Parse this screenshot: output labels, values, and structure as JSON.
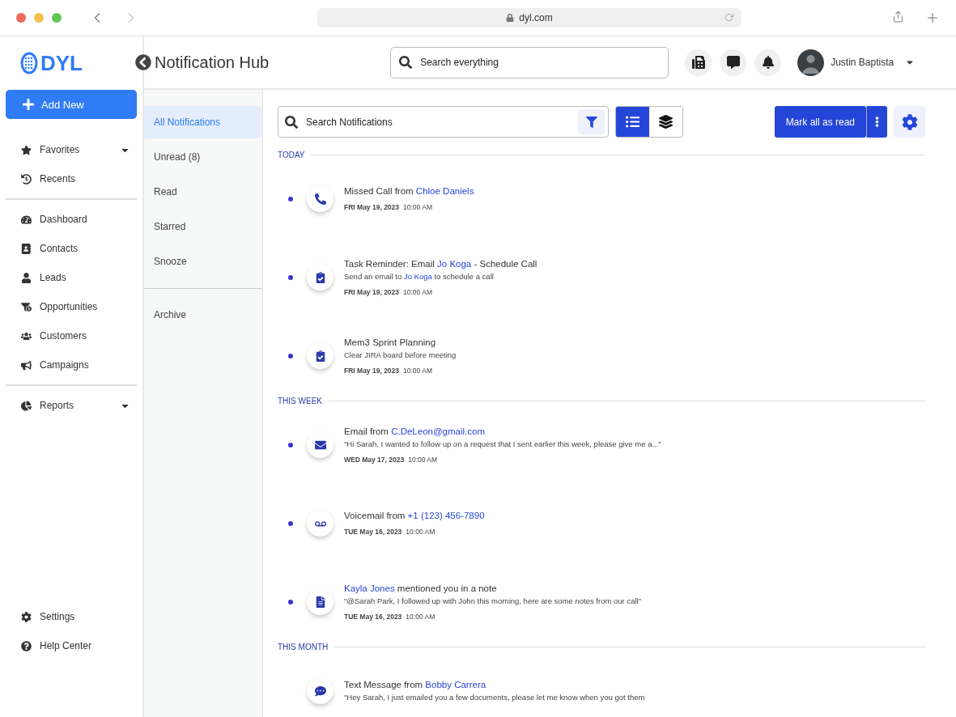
{
  "browser": {
    "url": "dyl.com"
  },
  "sidebar": {
    "logo": "DYL",
    "add_button": "Add New",
    "groups": [
      [
        {
          "label": "Favorites",
          "has_menu": true
        },
        {
          "label": "Recents",
          "has_menu": false
        }
      ],
      [
        {
          "label": "Dashboard",
          "has_menu": false
        },
        {
          "label": "Contacts",
          "has_menu": false
        },
        {
          "label": "Leads",
          "has_menu": false
        },
        {
          "label": "Opportunities",
          "has_menu": false
        },
        {
          "label": "Customers",
          "has_menu": false
        },
        {
          "label": "Campaigns",
          "has_menu": false
        }
      ],
      [
        {
          "label": "Reports",
          "has_menu": true
        }
      ]
    ],
    "footer": [
      {
        "label": "Settings"
      },
      {
        "label": "Help Center"
      }
    ]
  },
  "header": {
    "title": "Notification Hub",
    "search": {
      "placeholder": "Search everything"
    },
    "user": {
      "name": "Justin Baptista"
    }
  },
  "filters": [
    [
      {
        "label": "All Notifications",
        "selected": true
      },
      {
        "label": "Unread (8)",
        "selected": false
      },
      {
        "label": "Read",
        "selected": false
      },
      {
        "label": "Starred",
        "selected": false
      },
      {
        "label": "Snooze",
        "selected": false
      }
    ],
    [
      {
        "label": "Archive",
        "selected": false
      }
    ]
  ],
  "toolbar": {
    "search": {
      "placeholder": "Search Notifications"
    },
    "views": [
      {
        "kind": "list",
        "selected": true
      },
      {
        "kind": "stack",
        "selected": false
      }
    ],
    "mark_all": "Mark all as read"
  },
  "sections": [
    {
      "heading": "TODAY",
      "items": [
        {
          "kind": "call",
          "unread": true,
          "title": [
            {
              "text": "Missed Call from "
            },
            {
              "text": "Chloe Daniels",
              "link": true
            }
          ],
          "day": "FRI May 19, 2023",
          "time": "10:00 AM"
        },
        {
          "kind": "task",
          "unread": true,
          "title": [
            {
              "text": "Task Reminder: Email "
            },
            {
              "text": "Jo Koga",
              "link": true
            },
            {
              "text": " - Schedule Call"
            }
          ],
          "body": [
            {
              "text": "Send an email to "
            },
            {
              "text": "Jo Koga",
              "link": true
            },
            {
              "text": " to schedule a call"
            }
          ],
          "day": "FRI May 19, 2023",
          "time": "10:00 AM"
        },
        {
          "kind": "task",
          "unread": true,
          "title": [
            {
              "text": "Mem3 Sprint Planning"
            }
          ],
          "body": [
            {
              "text": "Clear JIRA board before meeting"
            }
          ],
          "day": "FRI May 19, 2023",
          "time": "10:00 AM"
        }
      ]
    },
    {
      "heading": "THIS WEEK",
      "items": [
        {
          "kind": "email",
          "unread": true,
          "title": [
            {
              "text": "Email from "
            },
            {
              "text": "C.DeLeon@gmail.com",
              "link": true
            }
          ],
          "body": [
            {
              "text": "\"Hi Sarah, I wanted to follow up on a request that I sent earlier this week, please give me a...\""
            }
          ],
          "day": "WED May 17, 2023",
          "time": "10:00 AM"
        },
        {
          "kind": "voicemail",
          "unread": true,
          "title": [
            {
              "text": "Voicemail from "
            },
            {
              "text": "+1 (123) 456-7890",
              "link": true
            }
          ],
          "day": "TUE May 16, 2023",
          "time": "10:00 AM"
        },
        {
          "kind": "note",
          "unread": true,
          "title": [
            {
              "text": "Kayla Jones",
              "link": true
            },
            {
              "text": " mentioned you in a note"
            }
          ],
          "body": [
            {
              "text": "\"@Sarah Park, I followed up with John this morning, here are some notes from our call\""
            }
          ],
          "day": "TUE May 16, 2023",
          "time": "10:00 AM"
        }
      ]
    },
    {
      "heading": "THIS MONTH",
      "items": [
        {
          "kind": "sms",
          "title": [
            {
              "text": "Text Message from "
            },
            {
              "text": "Bobby Carrera",
              "link": true
            }
          ],
          "body": [
            {
              "text": "\"Hey Sarah, I just emailed you a few documents, please let me know when you got them"
            }
          ]
        }
      ]
    }
  ]
}
